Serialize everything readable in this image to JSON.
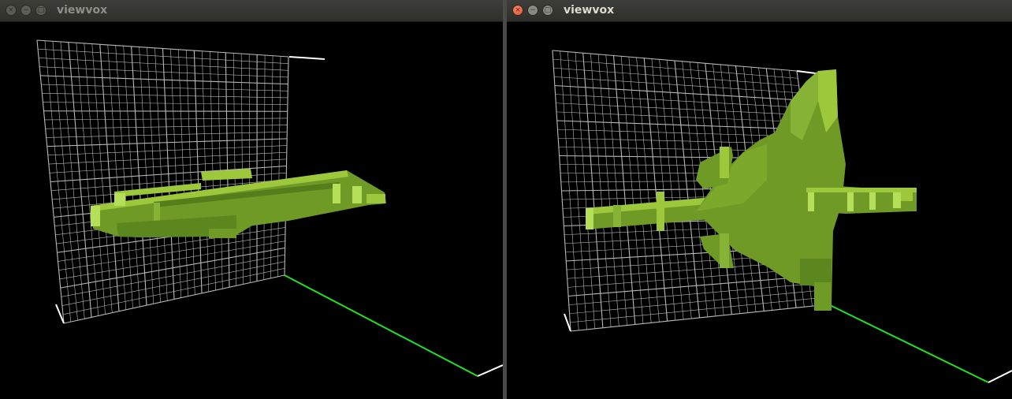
{
  "windows": [
    {
      "title": "viewvox",
      "focused": false,
      "buttons": {
        "close": "×",
        "minimize": "−",
        "maximize": "□"
      }
    },
    {
      "title": "viewvox",
      "focused": true,
      "buttons": {
        "close": "×",
        "minimize": "−",
        "maximize": "□"
      }
    }
  ],
  "colors": {
    "voxel_top": "#9ec83c",
    "voxel_side": "#6f9a26",
    "voxel_dark": "#4e6f18",
    "grid": "#b9b9b9",
    "axis_green": "#22e022",
    "axis_white": "#ffffff",
    "background": "#000000"
  }
}
